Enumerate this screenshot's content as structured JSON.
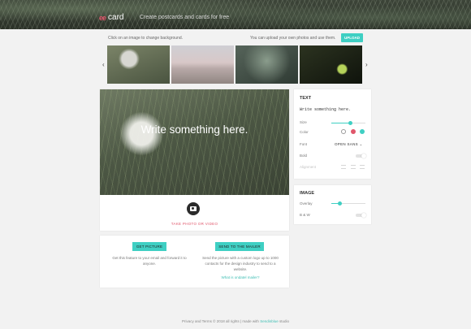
{
  "header": {
    "logo_mark": "ee",
    "logo_text": "card",
    "tagline": "Create postcards and cards for free"
  },
  "picker": {
    "instruction": "Click on an image to change background.",
    "upload_prompt": "You can upload your own photos and use them.",
    "upload_label": "UPLOAD",
    "prev_icon": "chevron-left-icon",
    "next_icon": "chevron-right-icon",
    "thumbnails": [
      "Dandelion",
      "Lake",
      "Forest",
      "Plant"
    ]
  },
  "card": {
    "message": "Write something here.",
    "take_photo_label": "TAKE PHOTO OR VIDEO"
  },
  "actions": {
    "get_picture_label": "GET PICTURE",
    "send_label": "SEND TO THE MAILER",
    "get_description": "Get this feature to your email and forward it to anyone.",
    "send_description": "Send the picture with a custom logo up to 1000 contacts for the design industry to send to a website.",
    "learn_more": "What is ondatel mailer?"
  },
  "text_panel": {
    "title": "TEXT",
    "sample": "Write something here.",
    "size_label": "Size",
    "size_value": 0.55,
    "color_label": "Color",
    "colors": [
      "#ffffff",
      "#e0566b",
      "#3fcfc3"
    ],
    "font_label": "Font",
    "font_value": "OPEN SANS",
    "bold_label": "Bold",
    "alignment_label": "Alignment"
  },
  "image_panel": {
    "title": "IMAGE",
    "overlay_label": "Overlay",
    "overlay_value": 0.25,
    "bw_label": "B & W"
  },
  "footer": {
    "prefix": "Privacy and Terms",
    "middle": "© 2018 all rights  |  made with",
    "link": "Sendinblue",
    "suffix": "studio"
  },
  "colors": {
    "accent": "#3fcfc3",
    "brand_pink": "#e0566b"
  }
}
